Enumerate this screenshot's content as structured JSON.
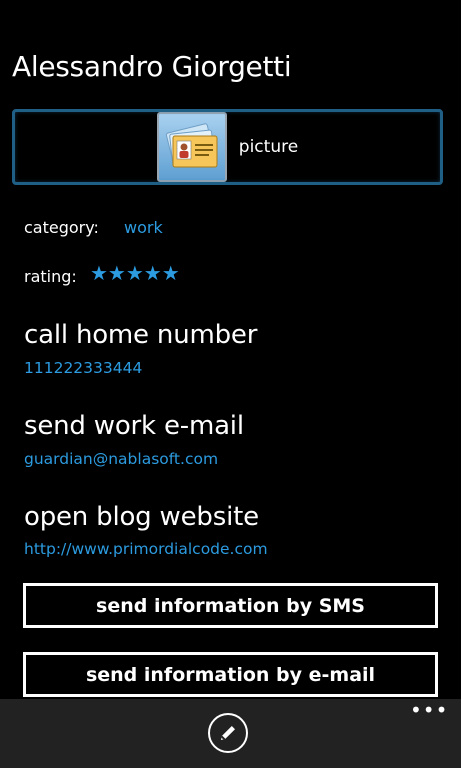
{
  "contact": {
    "name": "Alessandro Giorgetti"
  },
  "picture": {
    "label": "picture",
    "icon": "contact-card-icon"
  },
  "category": {
    "label": "category:",
    "value": "work"
  },
  "rating": {
    "label": "rating:",
    "stars": 5,
    "max": 5,
    "glyph": "★★★★★"
  },
  "actions": [
    {
      "title": "call home number",
      "value": "111222333444"
    },
    {
      "title": "send work e-mail",
      "value": "guardian@nablasoft.com"
    },
    {
      "title": "open blog website",
      "value": "http://www.primordialcode.com"
    }
  ],
  "buttons": {
    "sms": "send information by SMS",
    "email": "send information by e-mail"
  },
  "appbar": {
    "edit_icon": "edit-pencil-icon",
    "more": "•••"
  },
  "colors": {
    "accent": "#2c9be0",
    "background": "#000000",
    "appbar": "#222222"
  }
}
